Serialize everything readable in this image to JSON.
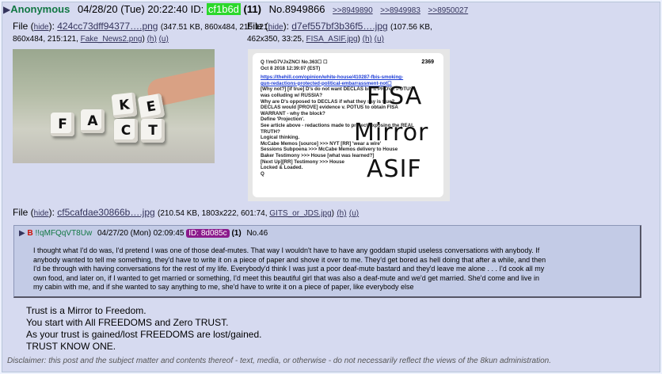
{
  "post": {
    "name": "Anonymous",
    "datetime": "04/28/20 (Tue) 20:22:40",
    "id_label": "ID:",
    "id": "cf1b6d",
    "reply_count": "(11)",
    "number": "No.8949866",
    "backlinks": [
      ">>8949890",
      ">>8949983",
      ">>8950027"
    ]
  },
  "files": [
    {
      "prefix": "File (",
      "hide": "hide",
      "name": "424cc73dff94377….png",
      "meta": "(347.51 KB, 860x484, 215:121, ",
      "orig": "Fake_News2.png",
      "h": "(h)",
      "u": "(u)"
    },
    {
      "prefix": "File (",
      "hide": "hide",
      "name": "d7ef557bf3b36f5….jpg",
      "meta": "(107.56 KB, 462x350, 33:25, ",
      "orig": "FISA_ASIF.jpg",
      "h": "(h)",
      "u": "(u)"
    },
    {
      "prefix": "File (",
      "hide": "hide",
      "name": "cf5cafdae30866b….jpg",
      "meta": "(210.54 KB, 1803x222, 601:74, ",
      "orig": "GITS_or_JDS.jpg",
      "h": "(h)",
      "u": "(u)"
    }
  ],
  "fact_image": {
    "letters": [
      "F",
      "A",
      "K",
      "C",
      "E",
      "T"
    ]
  },
  "fisa_image": {
    "header": "Q !!mG7VJxZNCI No.363☐  ☐",
    "date": "Oct 8 2018 12:39:07 (EST)",
    "num": "2369",
    "lines": [
      "https://thehill.com/opinion/white-house/410287-fbis-smoking-",
      "gun-redactions-protected-political-embarrassment-not☐",
      "[Why not?] [if true] D's do not want DECLAS b/c it PROVE POTUS",
      "was colluding w/ RUSSIA?",
      "Why are D's opposed to DECLAS if what they say is true?",
      "DECLAS would [PROVE] evidence v. POTUS to obtain FISA",
      "WARRANT - why the block?",
      "Define 'Projection'.",
      "See article above - redactions made to protect exposing the REAL",
      "TRUTH?",
      "Logical thinking.",
      "McCabe Memos [source] >>> NYT [RR] 'wear a wire'",
      "Sessions Subpoena >>> McCabe Memos delivery to House",
      "Baker Testimony >>> House [what was learned?]",
      "[Next Up][RR] Testimony >>> House",
      "Locked & Loaded.",
      "Q"
    ],
    "overlay": [
      "FISA",
      "Mirror",
      "ASIF"
    ]
  },
  "quoted": {
    "subject": "B",
    "trip": "!!qMFQqVT8Uw",
    "datetime": "04/27/20 (Mon) 02:09:45",
    "id": "ID: 8d085c",
    "count": "(1)",
    "number": "No.46",
    "lines": [
      "I thought what I'd do was, I'd pretend I was one of those deaf-mutes. That way I wouldn't have to have any goddam stupid useless conversations with anybody. If",
      "anybody wanted to tell me something, they'd have to write it on a piece of paper and shove it over to me. They'd get bored as hell doing that after a while, and then",
      "I'd be through with having conversations for the rest of my life. Everybody'd think I was just a poor deaf-mute bastard and they'd leave me alone . . . I'd cook all my",
      "own food, and later on, if I wanted to get married or something, I'd meet this beautiful girl that was also a deaf-mute and we'd get married. She'd come and live in",
      "my cabin with me, and if she wanted to say anything to me, she'd have to write it on a piece of paper, like everybody else"
    ]
  },
  "body": [
    "Trust is a Mirror to Freedom.",
    "You start with All FREEDOMS and Zero TRUST.",
    "As your trust is gained/lost FREEDOMS are lost/gained.",
    "TRUST KNOW ONE."
  ],
  "disclaimer": "Disclaimer: this post and the subject matter and contents thereof - text, media, or otherwise - do not necessarily reflect the views of the 8kun administration."
}
